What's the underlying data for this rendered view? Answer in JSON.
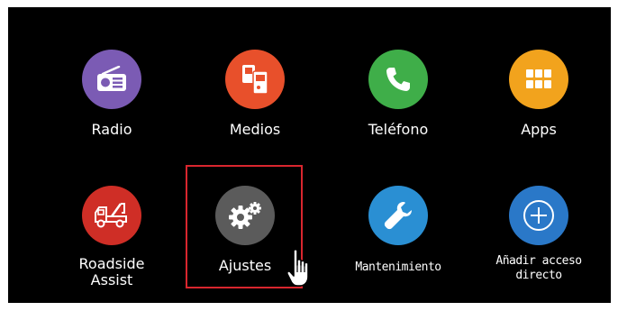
{
  "tiles": [
    {
      "id": "radio",
      "label": "Radio",
      "color": "#7b5bb4",
      "icon": "radio-icon"
    },
    {
      "id": "medios",
      "label": "Medios",
      "color": "#e8502b",
      "icon": "media-icon"
    },
    {
      "id": "telefono",
      "label": "Teléfono",
      "color": "#3fae49",
      "icon": "phone-icon"
    },
    {
      "id": "apps",
      "label": "Apps",
      "color": "#f2a31d",
      "icon": "apps-grid-icon"
    },
    {
      "id": "roadside",
      "label_lines": [
        "Roadside",
        "Assist"
      ],
      "color": "#cf2e26",
      "icon": "tow-truck-icon"
    },
    {
      "id": "ajustes",
      "label": "Ajustes",
      "color": "#5b5b5b",
      "icon": "gears-icon",
      "highlighted": true
    },
    {
      "id": "mantenimiento",
      "label": "Mantenimiento",
      "color": "#2a8fd3",
      "icon": "wrench-icon"
    },
    {
      "id": "anadir",
      "label_lines": [
        "Añadir acceso",
        "directo"
      ],
      "color": "#2a78c8",
      "icon": "plus-circle-icon"
    }
  ],
  "highlight_color": "#d9262e",
  "pointer_icon": "hand-pointer-icon"
}
